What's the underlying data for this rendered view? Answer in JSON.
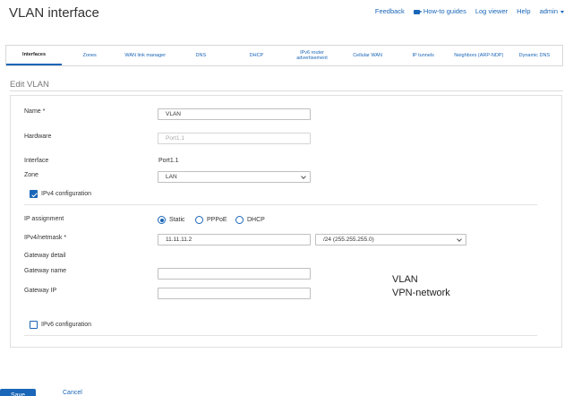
{
  "page": {
    "title": "VLAN interface"
  },
  "topnav": {
    "feedback": "Feedback",
    "how_to": "How-to guides",
    "log_viewer": "Log viewer",
    "help": "Help",
    "user": "admin"
  },
  "tabs": [
    {
      "label": "Interfaces",
      "active": true
    },
    {
      "label": "Zones"
    },
    {
      "label": "WAN link manager"
    },
    {
      "label": "DNS"
    },
    {
      "label": "DHCP"
    },
    {
      "label": "IPv6 router advertisement"
    },
    {
      "label": "Cellular WAN"
    },
    {
      "label": "IP tunnels"
    },
    {
      "label": "Neighbors (ARP-NDP)"
    },
    {
      "label": "Dynamic DNS"
    }
  ],
  "form": {
    "section_title": "Edit VLAN",
    "name_label": "Name *",
    "name_value": "VLAN",
    "hardware_label": "Hardware",
    "hardware_value": "Port1.1",
    "interface_label": "Interface",
    "interface_value": "Port1.1",
    "zone_label": "Zone",
    "zone_value": "LAN",
    "ipv4_config_label": "IPv4 configuration",
    "ip_assignment_label": "IP assignment",
    "ip_options": [
      "Static",
      "PPPoE",
      "DHCP"
    ],
    "ip_selected": "Static",
    "ipv4_netmask_label": "IPv4/netmask *",
    "ipv4_value": "11.11.11.2",
    "netmask_value": "/24 (255.255.255.0)",
    "gateway_detail_label": "Gateway detail",
    "gateway_name_label": "Gateway name",
    "gateway_name_value": "",
    "gateway_ip_label": "Gateway IP",
    "gateway_ip_value": "",
    "ipv6_config_label": "IPv6 configuration"
  },
  "annotation": {
    "line1": "VLAN",
    "line2": "VPN-network"
  },
  "footer": {
    "save_label": "Save",
    "cancel_label": "Cancel"
  },
  "colors": {
    "accent": "#1a66b8"
  }
}
